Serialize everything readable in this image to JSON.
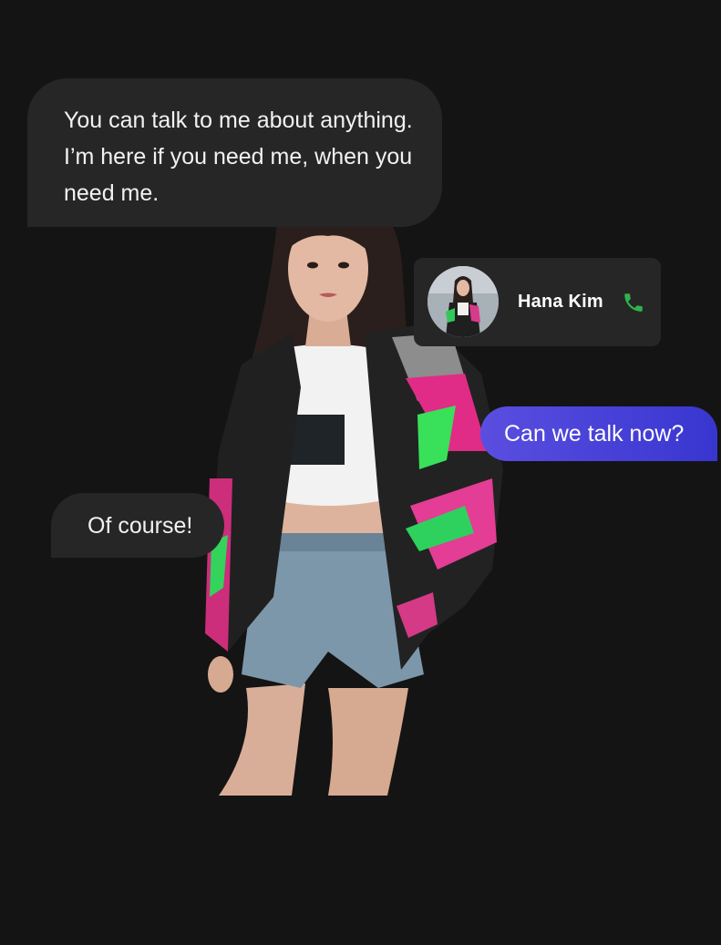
{
  "messages": {
    "top": "You can talk to me about anything. I’m here if you need me, when you need me.",
    "ask": "Can we talk now?",
    "reply": "Of course!"
  },
  "contact": {
    "name": "Hana Kim",
    "icon": "phone-icon",
    "icon_color": "#2fb34a"
  },
  "colors": {
    "background": "#141414",
    "bubble": "#262626",
    "accent": "#3a36d2"
  }
}
